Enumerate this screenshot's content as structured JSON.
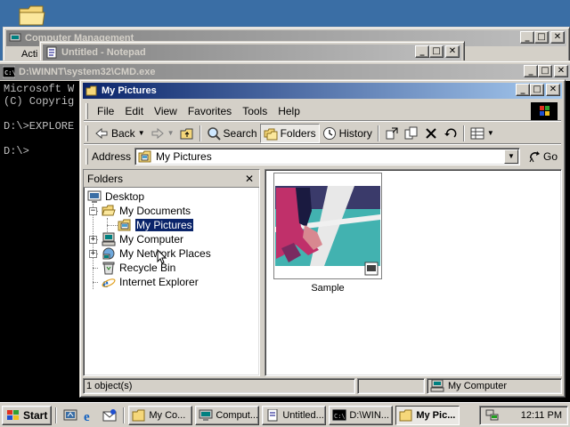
{
  "desktop": {
    "icon": "folder-icon"
  },
  "windows": {
    "computer_management": {
      "title": "Computer Management",
      "partial_text": "Acti"
    },
    "notepad": {
      "title": "Untitled - Notepad"
    },
    "cmd": {
      "title": "D:\\WINNT\\system32\\CMD.exe",
      "lines": [
        "Microsoft W",
        "(C) Copyrig",
        "",
        "D:\\>EXPLORE",
        "",
        "D:\\>"
      ]
    },
    "explorer": {
      "title": "My Pictures",
      "menu": [
        "File",
        "Edit",
        "View",
        "Favorites",
        "Tools",
        "Help"
      ],
      "toolbar": {
        "back": "Back",
        "search": "Search",
        "folders": "Folders",
        "history": "History"
      },
      "address": {
        "label": "Address",
        "value": "My Pictures",
        "go": "Go"
      },
      "folders_pane": {
        "title": "Folders",
        "items": [
          {
            "label": "Desktop",
            "icon": "desktop-icon"
          },
          {
            "label": "My Documents",
            "icon": "open-folder-icon"
          },
          {
            "label": "My Pictures",
            "icon": "pictures-folder-icon",
            "selected": true
          },
          {
            "label": "My Computer",
            "icon": "computer-icon"
          },
          {
            "label": "My Network Places",
            "icon": "network-icon"
          },
          {
            "label": "Recycle Bin",
            "icon": "recycle-bin-icon"
          },
          {
            "label": "Internet Explorer",
            "icon": "ie-icon"
          }
        ]
      },
      "files": [
        {
          "name": "Sample",
          "icon": "image-thumbnail"
        }
      ],
      "status": {
        "count": "1 object(s)",
        "zone": "My Computer"
      }
    }
  },
  "taskbar": {
    "start": "Start",
    "tasks": [
      {
        "label": "My Co...",
        "icon": "folder-icon"
      },
      {
        "label": "Comput...",
        "icon": "computer-management-icon"
      },
      {
        "label": "Untitled...",
        "icon": "notepad-icon"
      },
      {
        "label": "D:\\WIN...",
        "icon": "cmd-icon"
      },
      {
        "label": "My Pic...",
        "icon": "folder-icon",
        "active": true
      }
    ],
    "clock": "12:11 PM"
  }
}
